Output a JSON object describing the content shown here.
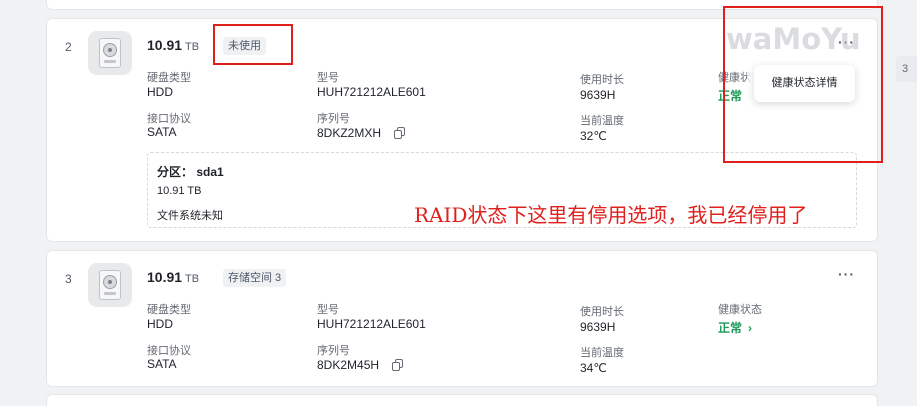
{
  "disks": [
    {
      "index": "2",
      "capacity": "10.91",
      "unit": "TB",
      "status_tag": "未使用",
      "more_label": "···",
      "fields": {
        "type_label": "硬盘类型",
        "type_value": "HDD",
        "interface_label": "接口协议",
        "interface_value": "SATA",
        "model_label": "型号",
        "model_value": "HUH721212ALE601",
        "serial_label": "序列号",
        "serial_value": "8DKZ2MXH",
        "hours_label": "使用时长",
        "hours_value": "9639H",
        "temp_label": "当前温度",
        "temp_value": "32℃",
        "health_label": "健康状",
        "health_value": "正常"
      },
      "partition": {
        "title": "分区： sda1",
        "size": "10.91 TB",
        "filesystem": "文件系统未知"
      },
      "menu": {
        "item": "健康状态详情"
      }
    },
    {
      "index": "3",
      "capacity": "10.91",
      "unit": "TB",
      "status_tag": "存储空间 3",
      "more_label": "···",
      "fields": {
        "type_label": "硬盘类型",
        "type_value": "HDD",
        "interface_label": "接口协议",
        "interface_value": "SATA",
        "model_label": "型号",
        "model_value": "HUH721212ALE601",
        "serial_label": "序列号",
        "serial_value": "8DK2M45H",
        "hours_label": "使用时长",
        "hours_value": "9639H",
        "temp_label": "当前温度",
        "temp_value": "34℃",
        "health_label": "健康状态",
        "health_value": "正常"
      }
    }
  ],
  "annotation": "RAID状态下这里有停用选项，我已经停用了",
  "watermark": "waMoYu",
  "edge_tab": "3",
  "colors": {
    "accent_red": "#e0201c",
    "health_ok": "#1f9a5a"
  }
}
